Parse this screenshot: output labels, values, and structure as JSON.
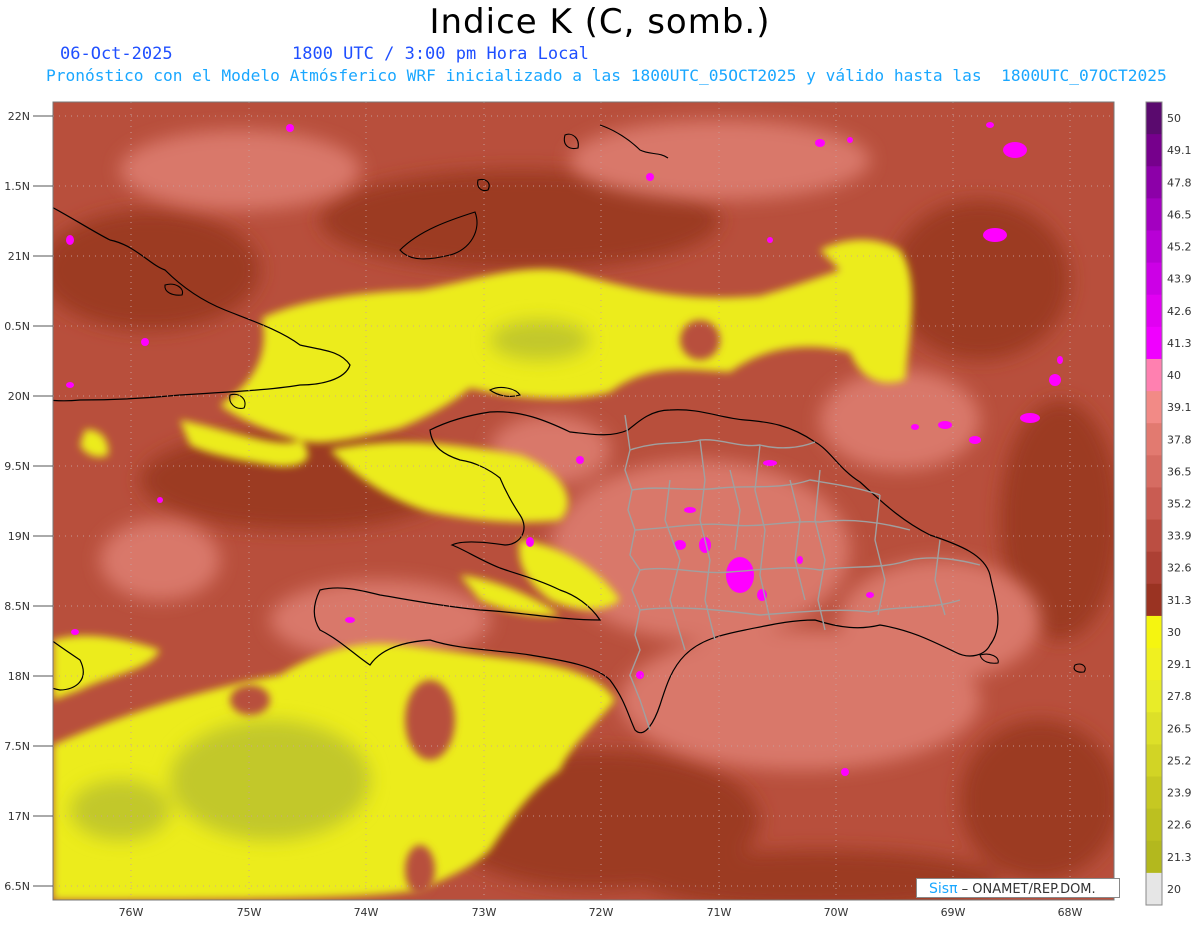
{
  "header": {
    "title": "Indice K (C, somb.)",
    "date": "06-Oct-2025",
    "time": "1800 UTC / 3:00 pm Hora Local",
    "description": "Pronóstico con el Modelo Atmósferico WRF inicializado a las 1800UTC_05OCT2025 y válido hasta las  1800UTC_07OCT2025"
  },
  "axes": {
    "lat_labels": [
      "22N",
      "1.5N",
      "21N",
      "0.5N",
      "20N",
      "9.5N",
      "19N",
      "8.5N",
      "18N",
      "7.5N",
      "17N",
      "6.5N"
    ],
    "lon_labels": [
      "76W",
      "75W",
      "74W",
      "73W",
      "72W",
      "71W",
      "70W",
      "69W",
      "68W"
    ]
  },
  "colorbar": {
    "labels": [
      "50",
      "49.1",
      "47.8",
      "46.5",
      "45.2",
      "43.9",
      "42.6",
      "41.3",
      "40",
      "39.1",
      "37.8",
      "36.5",
      "35.2",
      "33.9",
      "32.6",
      "31.3",
      "30",
      "29.1",
      "27.8",
      "26.5",
      "25.2",
      "23.9",
      "22.6",
      "21.3",
      "20"
    ],
    "colors": [
      "#5a0a6e",
      "#76008c",
      "#8c00a8",
      "#a300c0",
      "#b800d6",
      "#cc00e6",
      "#e100f2",
      "#f000ff",
      "#ff80b0",
      "#f28a86",
      "#e27a70",
      "#d66c62",
      "#c95c52",
      "#bb4e42",
      "#ac4034",
      "#9a3322",
      "#f5f510",
      "#f0f020",
      "#e8ec28",
      "#dde028",
      "#d2d425",
      "#c6c822",
      "#bcc020",
      "#b3b81e",
      "#e6e6e6"
    ]
  },
  "colors": {
    "base_brown": "#b84f3c",
    "dark_brown": "#9c3a22",
    "light_salmon": "#d9786a",
    "yellow": "#ecec1a",
    "olive": "#c2c82a",
    "magenta": "#ff00ff"
  },
  "credit": {
    "sis": "Sisπ",
    "text": "– ONAMET/REP.DOM."
  }
}
